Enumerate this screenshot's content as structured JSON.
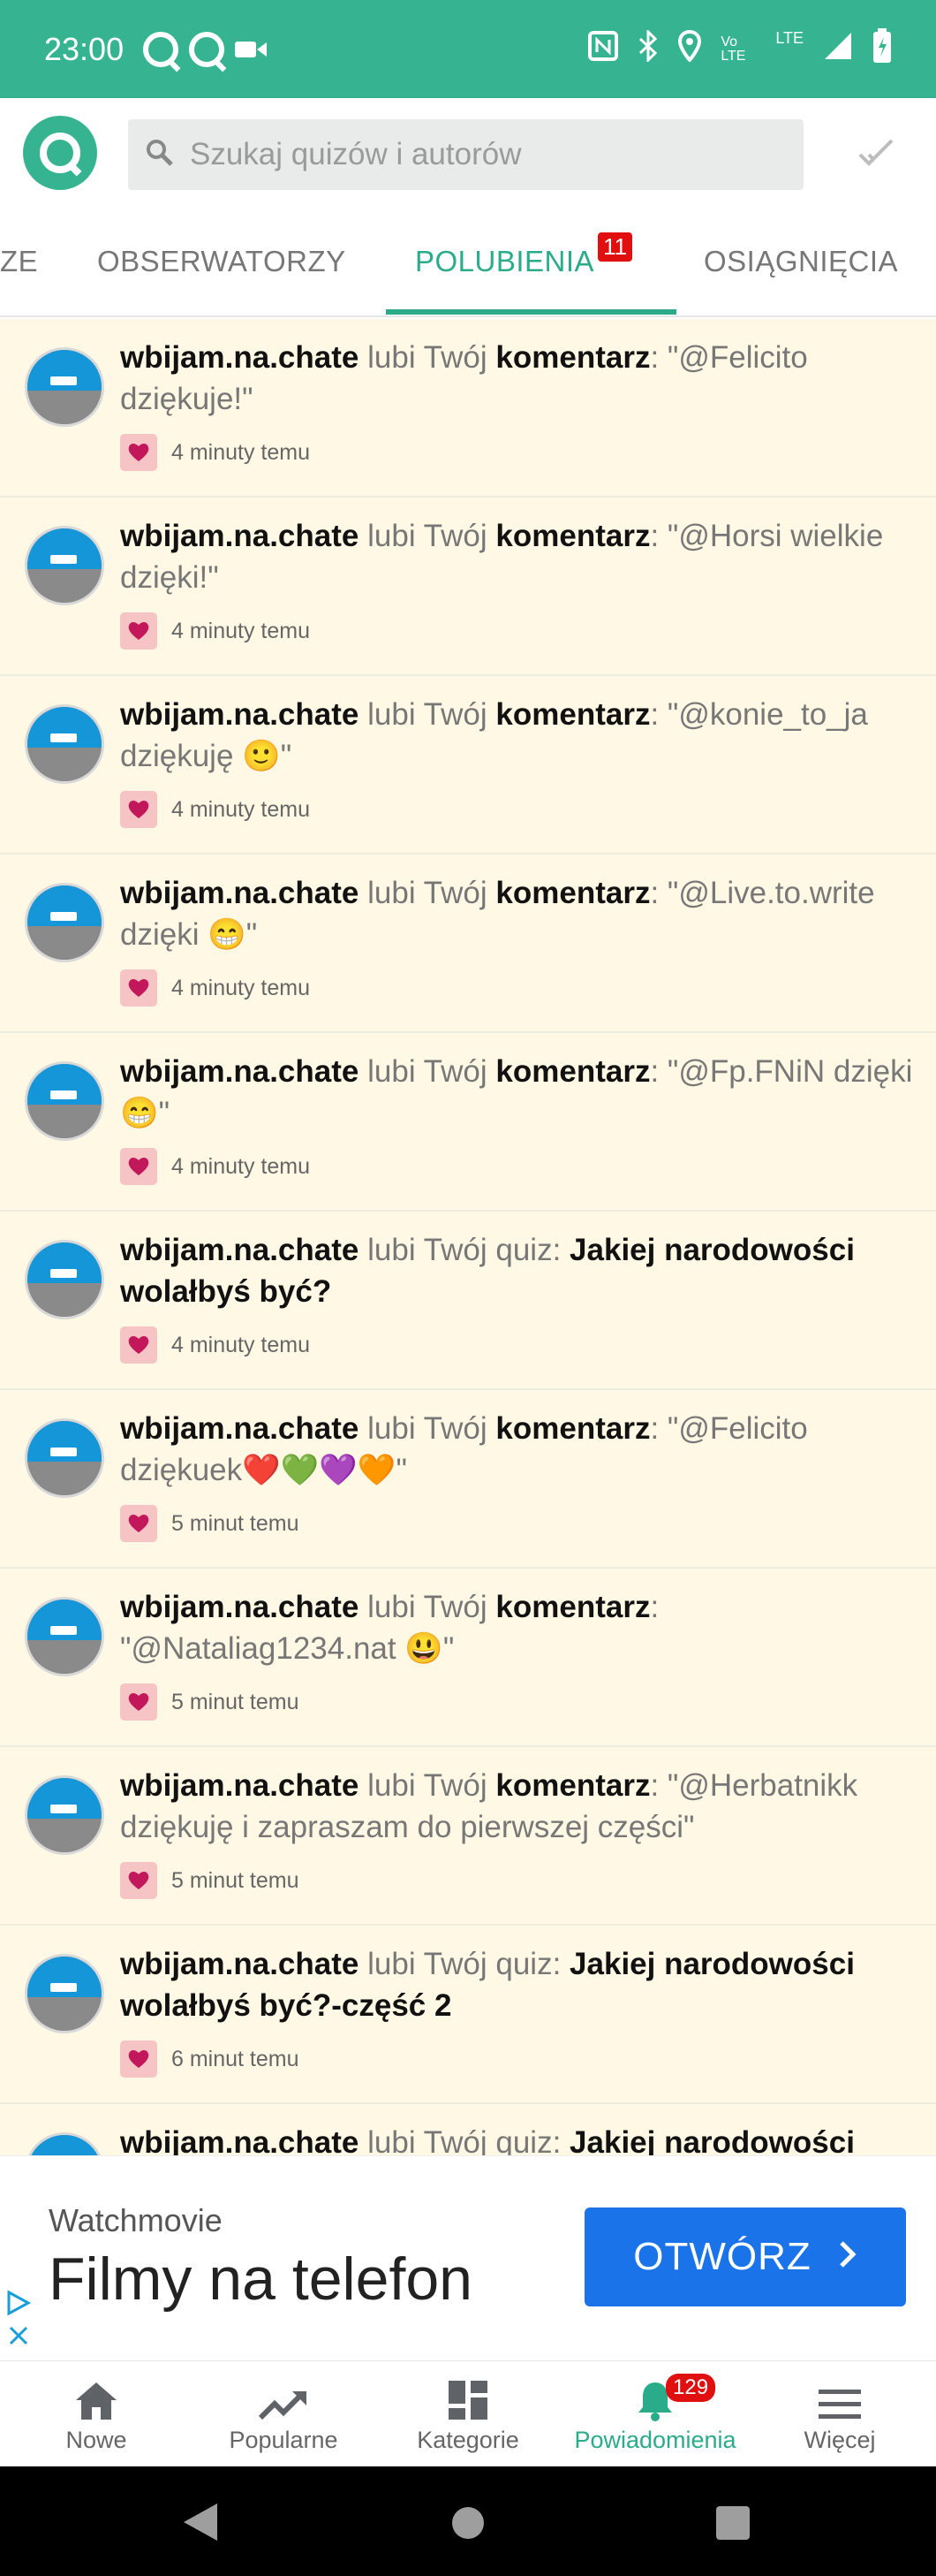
{
  "status_bar": {
    "time": "23:00",
    "network": "LTE"
  },
  "header": {
    "search_placeholder": "Szukaj quizów i autorów"
  },
  "tabs": [
    {
      "label": "ZE"
    },
    {
      "label": "OBSERWATORZY"
    },
    {
      "label": "POLUBIENIA",
      "badge": "11",
      "active": true
    },
    {
      "label": "OSIĄGNIĘCIA"
    }
  ],
  "notifications": [
    {
      "user": "wbijam.na.chate",
      "action": "lubi Twój",
      "object": "komentarz",
      "text": "\"@Felicito dziękuje!\"",
      "time": "4 minuty temu"
    },
    {
      "user": "wbijam.na.chate",
      "action": "lubi Twój",
      "object": "komentarz",
      "text": "\"@Horsi wielkie dzięki!\"",
      "time": "4 minuty temu"
    },
    {
      "user": "wbijam.na.chate",
      "action": "lubi Twój",
      "object": "komentarz",
      "text": "\"@konie_to_ja dziękuję 🙂\"",
      "time": "4 minuty temu"
    },
    {
      "user": "wbijam.na.chate",
      "action": "lubi Twój",
      "object": "komentarz",
      "text": "\"@Live.to.write dzięki 😁\"",
      "time": "4 minuty temu"
    },
    {
      "user": "wbijam.na.chate",
      "action": "lubi Twój",
      "object": "komentarz",
      "text": "\"@Fp.FNiN dzięki 😁\"",
      "time": "4 minuty temu"
    },
    {
      "user": "wbijam.na.chate",
      "action": "lubi Twój quiz:",
      "object": "Jakiej narodowości wolałbyś być?",
      "text": "",
      "time": "4 minuty temu"
    },
    {
      "user": "wbijam.na.chate",
      "action": "lubi Twój",
      "object": "komentarz",
      "text": "\"@Felicito dziękuek❤️💚💜🧡\"",
      "time": "5 minut temu"
    },
    {
      "user": "wbijam.na.chate",
      "action": "lubi Twój",
      "object": "komentarz",
      "text": "\"@Nataliag1234.nat 😃\"",
      "time": "5 minut temu"
    },
    {
      "user": "wbijam.na.chate",
      "action": "lubi Twój",
      "object": "komentarz",
      "text": "\"@Herbatnikk dziękuję i zapraszam do pierwszej części\"",
      "time": "5 minut temu"
    },
    {
      "user": "wbijam.na.chate",
      "action": "lubi Twój quiz:",
      "object": "Jakiej narodowości wolałbyś być?-część 2",
      "text": "",
      "time": "6 minut temu"
    },
    {
      "user": "wbijam.na.chate",
      "action": "lubi Twój quiz:",
      "object": "Jakiej narodowości",
      "text": "",
      "time": ""
    }
  ],
  "ad": {
    "brand": "Watchmovie",
    "title": "Filmy na telefon",
    "button": "OTWÓRZ"
  },
  "bottom_nav": [
    {
      "label": "Nowe",
      "icon": "home-icon"
    },
    {
      "label": "Popularne",
      "icon": "trending-icon"
    },
    {
      "label": "Kategorie",
      "icon": "dashboard-icon"
    },
    {
      "label": "Powiadomienia",
      "icon": "bell-icon",
      "badge": "129",
      "active": true
    },
    {
      "label": "Więcej",
      "icon": "menu-icon"
    }
  ],
  "colors": {
    "brand": "#36b491",
    "accent": "#2aab8a",
    "list_bg": "#fff8e5",
    "ad_button": "#1a73e8",
    "badge": "#e01010"
  }
}
